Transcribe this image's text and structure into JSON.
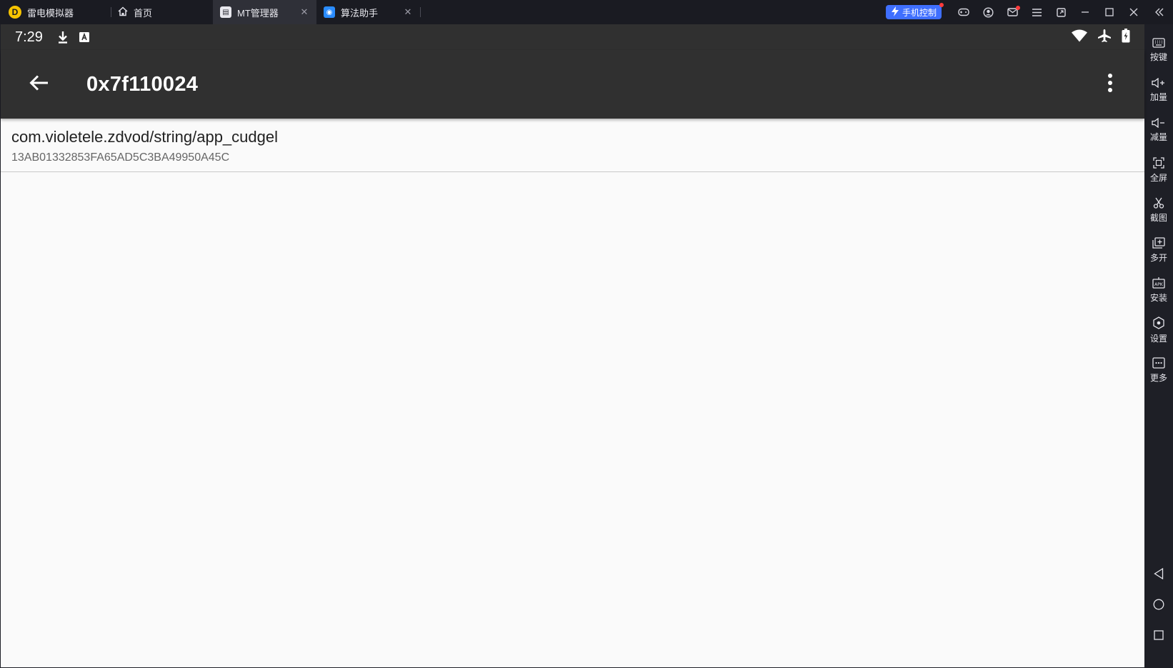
{
  "titlebar": {
    "app_name": "雷电模拟器",
    "tabs": [
      {
        "label": "首页",
        "icon": "home-icon"
      },
      {
        "label": "MT管理器",
        "icon": "mt-app-icon",
        "active": true
      },
      {
        "label": "算法助手",
        "icon": "algo-app-icon"
      }
    ],
    "phone_control_label": "手机控制",
    "window_buttons": [
      "gamepad-icon",
      "account-icon",
      "mail-icon",
      "menu-icon",
      "screen-icon",
      "minimize-icon",
      "maximize-icon",
      "close-icon",
      "collapse-sidebar-icon"
    ]
  },
  "statusbar": {
    "time": "7:29",
    "left_icons": [
      "download-icon",
      "font-a-icon"
    ],
    "right_icons": [
      "wifi-icon",
      "airplane-icon",
      "battery-charging-icon"
    ]
  },
  "appbar": {
    "title": "0x7f110024"
  },
  "list": [
    {
      "title": "com.violetele.zdvod/string/app_cudgel",
      "subtitle": "13AB01332853FA65AD5C3BA49950A45C"
    }
  ],
  "sidebar": {
    "buttons": [
      {
        "label": "按键",
        "icon": "keyboard-icon"
      },
      {
        "label": "加量",
        "icon": "volume-up-icon"
      },
      {
        "label": "减量",
        "icon": "volume-down-icon"
      },
      {
        "label": "全屏",
        "icon": "fullscreen-icon"
      },
      {
        "label": "截图",
        "icon": "scissors-icon"
      },
      {
        "label": "多开",
        "icon": "multi-instance-icon"
      },
      {
        "label": "安装",
        "icon": "apk-install-icon"
      },
      {
        "label": "设置",
        "icon": "settings-icon"
      },
      {
        "label": "更多",
        "icon": "more-icon"
      }
    ],
    "nav": [
      "nav-back-icon",
      "nav-home-icon",
      "nav-recents-icon"
    ]
  },
  "colors": {
    "appbar": "#303030",
    "chrome": "#1a1b22",
    "accent": "#3f6fff"
  }
}
